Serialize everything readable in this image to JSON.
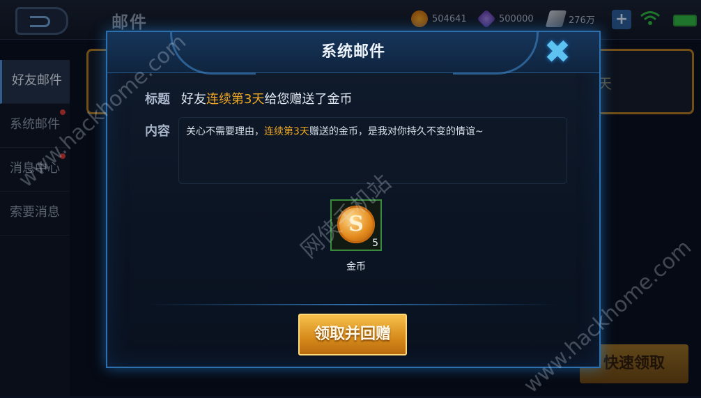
{
  "header": {
    "title": "邮件",
    "resources": [
      {
        "icon": "gold-coin-icon",
        "value": "504641"
      },
      {
        "icon": "diamond-icon",
        "value": "500000"
      },
      {
        "icon": "voucher-icon",
        "value": "276万"
      }
    ]
  },
  "sidebar": {
    "items": [
      {
        "label": "好友邮件",
        "active": true,
        "badge": false
      },
      {
        "label": "系统邮件",
        "active": false,
        "badge": true
      },
      {
        "label": "消息中心",
        "active": false,
        "badge": true
      },
      {
        "label": "索要消息",
        "active": false,
        "badge": false
      }
    ]
  },
  "background": {
    "mail_card_text": "天",
    "quick_claim_label": "快速领取"
  },
  "modal": {
    "title": "系统邮件",
    "subject_label": "标题",
    "subject_prefix": "好友",
    "subject_highlight": "连续第3天",
    "subject_suffix": "给您赠送了金币",
    "content_label": "内容",
    "content_prefix": "关心不需要理由，",
    "content_highlight": "连续第3天",
    "content_suffix": "赠送的金币，是我对你持久不变的情谊~",
    "attachment": {
      "name": "金币",
      "count": "5",
      "icon": "gold-coin-icon"
    },
    "claim_button_label": "领取并回赠"
  },
  "watermarks": [
    "www.hackhome.com",
    "网侠手机站",
    "www.hackhome.com"
  ],
  "colors": {
    "accent_gold": "#f0a824",
    "frame_blue": "#2e6fae",
    "attachment_border": "#3a8a3e"
  }
}
